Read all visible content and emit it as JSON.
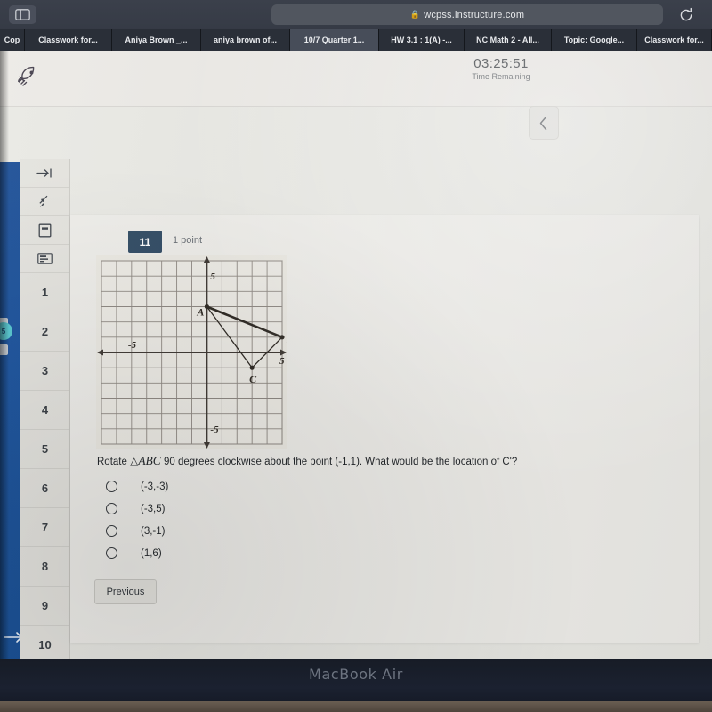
{
  "browser": {
    "url": "wcpss.instructure.com",
    "lock_icon": "lock-icon",
    "sidebar_toggle_icon": "sidebar-toggle-icon",
    "reload_icon": "reload-icon",
    "tabs": [
      {
        "label": "Cop",
        "active": false
      },
      {
        "label": "Classwork for...",
        "active": false
      },
      {
        "label": "Aniya Brown _...",
        "active": false
      },
      {
        "label": "aniya brown of...",
        "active": false
      },
      {
        "label": "10/7 Quarter 1...",
        "active": true
      },
      {
        "label": "HW 3.1 : 1(A) -...",
        "active": false
      },
      {
        "label": "NC Math 2 - All...",
        "active": false
      },
      {
        "label": "Topic: Google...",
        "active": false
      },
      {
        "label": "Classwork for...",
        "active": false
      }
    ]
  },
  "quiz_header": {
    "rocket_icon": "rocket-icon",
    "timer_value": "03:25:51",
    "timer_label": "Time Remaining",
    "collapse_icon": "chevron-left-icon"
  },
  "question_rail": {
    "icons": [
      "arrow-right-to-line-icon",
      "pin-icon",
      "note-icon",
      "list-icon"
    ],
    "numbers": [
      "1",
      "2",
      "3",
      "4",
      "5",
      "6",
      "7",
      "8",
      "9",
      "10"
    ]
  },
  "rail_bottom_icon": "arrow-right-to-line-icon",
  "rail_badge": "5",
  "question": {
    "number": "11",
    "points": "1 point",
    "prompt_before": "Rotate ",
    "triangle_symbol": "△",
    "triangle_label": "ABC",
    "prompt_after": " 90 degrees clockwise about the point (-1,1). What would be the location of C'?",
    "options": [
      {
        "label": "(-3,-3)",
        "selected": false
      },
      {
        "label": "(-3,5)",
        "selected": false
      },
      {
        "label": "(3,-1)",
        "selected": false
      },
      {
        "label": "(1,6)",
        "selected": false
      }
    ],
    "previous_label": "Previous"
  },
  "chart_data": {
    "type": "scatter",
    "title": "",
    "xlabel": "",
    "ylabel": "",
    "xlim": [
      -7,
      5
    ],
    "ylim": [
      -6,
      6
    ],
    "grid": true,
    "x_tick_labels": [
      {
        "value": -5,
        "text": "-5"
      },
      {
        "value": 5,
        "text": "5"
      }
    ],
    "y_tick_labels": [
      {
        "value": 5,
        "text": "5"
      },
      {
        "value": -5,
        "text": "-5"
      }
    ],
    "points": [
      {
        "name": "A",
        "x": 0,
        "y": 3
      },
      {
        "name": "B",
        "x": 5,
        "y": 1
      },
      {
        "name": "C",
        "x": 3,
        "y": -1
      }
    ],
    "polygon": [
      "A",
      "B",
      "C"
    ],
    "annotations": [
      "A",
      "B",
      "C"
    ]
  },
  "device": {
    "label": "MacBook Air"
  }
}
